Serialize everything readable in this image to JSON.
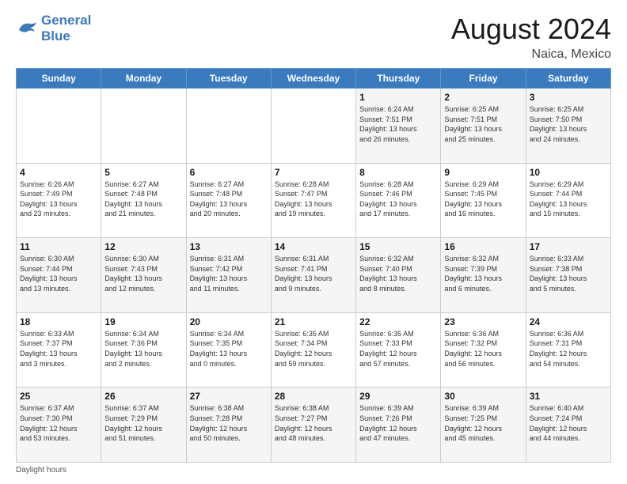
{
  "logo": {
    "line1": "General",
    "line2": "Blue"
  },
  "title": "August 2024",
  "location": "Naica, Mexico",
  "days_of_week": [
    "Sunday",
    "Monday",
    "Tuesday",
    "Wednesday",
    "Thursday",
    "Friday",
    "Saturday"
  ],
  "footer": "Daylight hours",
  "weeks": [
    [
      {
        "num": "",
        "info": ""
      },
      {
        "num": "",
        "info": ""
      },
      {
        "num": "",
        "info": ""
      },
      {
        "num": "",
        "info": ""
      },
      {
        "num": "1",
        "info": "Sunrise: 6:24 AM\nSunset: 7:51 PM\nDaylight: 13 hours\nand 26 minutes."
      },
      {
        "num": "2",
        "info": "Sunrise: 6:25 AM\nSunset: 7:51 PM\nDaylight: 13 hours\nand 25 minutes."
      },
      {
        "num": "3",
        "info": "Sunrise: 6:25 AM\nSunset: 7:50 PM\nDaylight: 13 hours\nand 24 minutes."
      }
    ],
    [
      {
        "num": "4",
        "info": "Sunrise: 6:26 AM\nSunset: 7:49 PM\nDaylight: 13 hours\nand 23 minutes."
      },
      {
        "num": "5",
        "info": "Sunrise: 6:27 AM\nSunset: 7:48 PM\nDaylight: 13 hours\nand 21 minutes."
      },
      {
        "num": "6",
        "info": "Sunrise: 6:27 AM\nSunset: 7:48 PM\nDaylight: 13 hours\nand 20 minutes."
      },
      {
        "num": "7",
        "info": "Sunrise: 6:28 AM\nSunset: 7:47 PM\nDaylight: 13 hours\nand 19 minutes."
      },
      {
        "num": "8",
        "info": "Sunrise: 6:28 AM\nSunset: 7:46 PM\nDaylight: 13 hours\nand 17 minutes."
      },
      {
        "num": "9",
        "info": "Sunrise: 6:29 AM\nSunset: 7:45 PM\nDaylight: 13 hours\nand 16 minutes."
      },
      {
        "num": "10",
        "info": "Sunrise: 6:29 AM\nSunset: 7:44 PM\nDaylight: 13 hours\nand 15 minutes."
      }
    ],
    [
      {
        "num": "11",
        "info": "Sunrise: 6:30 AM\nSunset: 7:44 PM\nDaylight: 13 hours\nand 13 minutes."
      },
      {
        "num": "12",
        "info": "Sunrise: 6:30 AM\nSunset: 7:43 PM\nDaylight: 13 hours\nand 12 minutes."
      },
      {
        "num": "13",
        "info": "Sunrise: 6:31 AM\nSunset: 7:42 PM\nDaylight: 13 hours\nand 11 minutes."
      },
      {
        "num": "14",
        "info": "Sunrise: 6:31 AM\nSunset: 7:41 PM\nDaylight: 13 hours\nand 9 minutes."
      },
      {
        "num": "15",
        "info": "Sunrise: 6:32 AM\nSunset: 7:40 PM\nDaylight: 13 hours\nand 8 minutes."
      },
      {
        "num": "16",
        "info": "Sunrise: 6:32 AM\nSunset: 7:39 PM\nDaylight: 13 hours\nand 6 minutes."
      },
      {
        "num": "17",
        "info": "Sunrise: 6:33 AM\nSunset: 7:38 PM\nDaylight: 13 hours\nand 5 minutes."
      }
    ],
    [
      {
        "num": "18",
        "info": "Sunrise: 6:33 AM\nSunset: 7:37 PM\nDaylight: 13 hours\nand 3 minutes."
      },
      {
        "num": "19",
        "info": "Sunrise: 6:34 AM\nSunset: 7:36 PM\nDaylight: 13 hours\nand 2 minutes."
      },
      {
        "num": "20",
        "info": "Sunrise: 6:34 AM\nSunset: 7:35 PM\nDaylight: 13 hours\nand 0 minutes."
      },
      {
        "num": "21",
        "info": "Sunrise: 6:35 AM\nSunset: 7:34 PM\nDaylight: 12 hours\nand 59 minutes."
      },
      {
        "num": "22",
        "info": "Sunrise: 6:35 AM\nSunset: 7:33 PM\nDaylight: 12 hours\nand 57 minutes."
      },
      {
        "num": "23",
        "info": "Sunrise: 6:36 AM\nSunset: 7:32 PM\nDaylight: 12 hours\nand 56 minutes."
      },
      {
        "num": "24",
        "info": "Sunrise: 6:36 AM\nSunset: 7:31 PM\nDaylight: 12 hours\nand 54 minutes."
      }
    ],
    [
      {
        "num": "25",
        "info": "Sunrise: 6:37 AM\nSunset: 7:30 PM\nDaylight: 12 hours\nand 53 minutes."
      },
      {
        "num": "26",
        "info": "Sunrise: 6:37 AM\nSunset: 7:29 PM\nDaylight: 12 hours\nand 51 minutes."
      },
      {
        "num": "27",
        "info": "Sunrise: 6:38 AM\nSunset: 7:28 PM\nDaylight: 12 hours\nand 50 minutes."
      },
      {
        "num": "28",
        "info": "Sunrise: 6:38 AM\nSunset: 7:27 PM\nDaylight: 12 hours\nand 48 minutes."
      },
      {
        "num": "29",
        "info": "Sunrise: 6:39 AM\nSunset: 7:26 PM\nDaylight: 12 hours\nand 47 minutes."
      },
      {
        "num": "30",
        "info": "Sunrise: 6:39 AM\nSunset: 7:25 PM\nDaylight: 12 hours\nand 45 minutes."
      },
      {
        "num": "31",
        "info": "Sunrise: 6:40 AM\nSunset: 7:24 PM\nDaylight: 12 hours\nand 44 minutes."
      }
    ]
  ]
}
